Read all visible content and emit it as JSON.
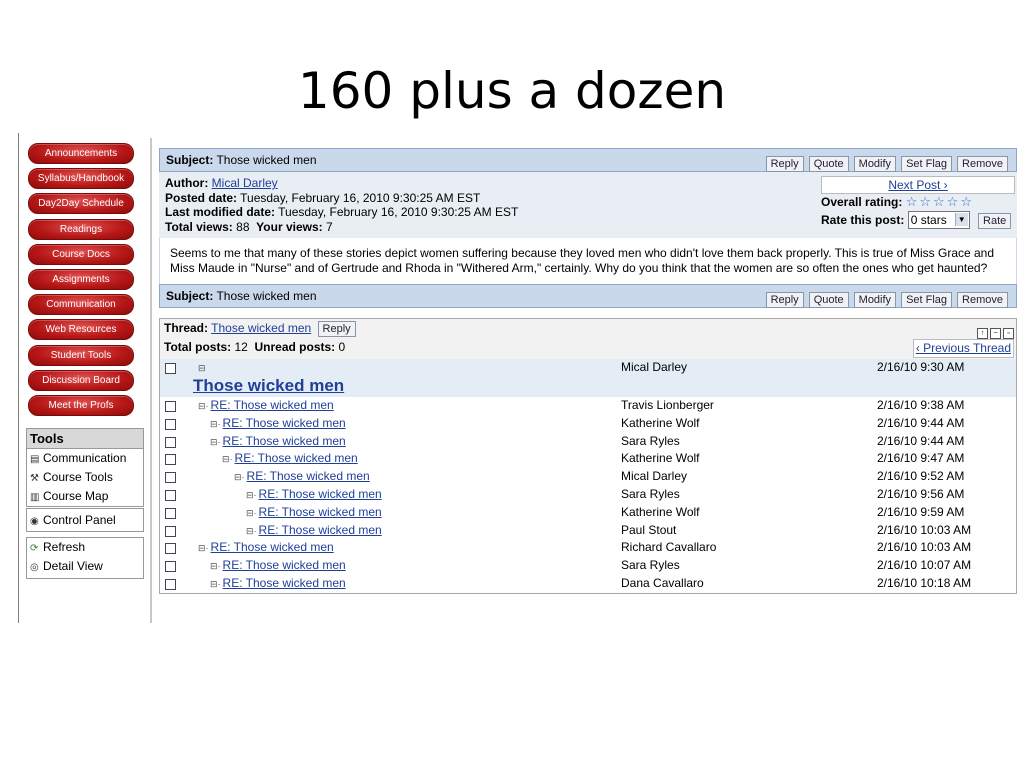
{
  "slide_title": "160 plus a dozen",
  "nav": [
    "Announcements",
    "Syllabus/Handbook",
    "Day2Day Schedule",
    "Readings",
    "Course Docs",
    "Assignments",
    "Communication",
    "Web Resources",
    "Student Tools",
    "Discussion Board",
    "Meet the Profs"
  ],
  "tools": {
    "header": "Tools",
    "items": [
      {
        "label": "Communication",
        "icon": "terminal-icon"
      },
      {
        "label": "Course Tools",
        "icon": "tools-icon"
      },
      {
        "label": "Course Map",
        "icon": "map-icon"
      }
    ]
  },
  "control_panel": "Control Panel",
  "refresh": "Refresh",
  "detail_view": "Detail View",
  "post": {
    "subject_label": "Subject:",
    "subject": "Those wicked men",
    "buttons": [
      "Reply",
      "Quote",
      "Modify",
      "Set Flag",
      "Remove"
    ],
    "author_label": "Author:",
    "author": "Mical Darley",
    "posted_label": "Posted date:",
    "posted": "Tuesday, February 16, 2010 9:30:25 AM EST",
    "modified_label": "Last modified date:",
    "modified": "Tuesday, February 16, 2010 9:30:25 AM EST",
    "total_views_label": "Total views:",
    "total_views": "88",
    "your_views_label": "Your views:",
    "your_views": "7",
    "next_post": "Next Post ›",
    "overall_rating_label": "Overall rating:",
    "overall_rating_stars": 0,
    "rate_label": "Rate this post:",
    "rate_value": "0 stars",
    "rate_button": "Rate",
    "body": "Seems to me that many of these stories depict women suffering because they loved men who didn't love them back properly. This is true of Miss Grace and Miss Maude in \"Nurse\" and of Gertrude and Rhoda in \"Withered Arm,\" certainly. Why do you think that the women are so often the ones who get haunted?"
  },
  "thread": {
    "label": "Thread:",
    "name": "Those wicked men",
    "reply": "Reply",
    "total_posts_label": "Total posts:",
    "total_posts": "12",
    "unread_label": "Unread posts:",
    "unread": "0",
    "prev_thread": "‹ Previous Thread",
    "top": {
      "title": "Those wicked men",
      "author": "Mical Darley",
      "date": "2/16/10 9:30 AM"
    },
    "rows": [
      {
        "title": "RE: Those wicked men",
        "author": "Travis Lionberger",
        "date": "2/16/10 9:38 AM",
        "depth": 1
      },
      {
        "title": "RE: Those wicked men",
        "author": "Katherine Wolf",
        "date": "2/16/10 9:44 AM",
        "depth": 2
      },
      {
        "title": "RE: Those wicked men",
        "author": "Sara Ryles",
        "date": "2/16/10 9:44 AM",
        "depth": 2
      },
      {
        "title": "RE: Those wicked men",
        "author": "Katherine Wolf",
        "date": "2/16/10 9:47 AM",
        "depth": 3
      },
      {
        "title": "RE: Those wicked men",
        "author": "Mical Darley",
        "date": "2/16/10 9:52 AM",
        "depth": 4
      },
      {
        "title": "RE: Those wicked men",
        "author": "Sara Ryles",
        "date": "2/16/10 9:56 AM",
        "depth": 5
      },
      {
        "title": "RE: Those wicked men",
        "author": "Katherine Wolf",
        "date": "2/16/10 9:59 AM",
        "depth": 5
      },
      {
        "title": "RE: Those wicked men",
        "author": "Paul Stout",
        "date": "2/16/10 10:03 AM",
        "depth": 5
      },
      {
        "title": "RE: Those wicked men",
        "author": "Richard Cavallaro",
        "date": "2/16/10 10:03 AM",
        "depth": 1
      },
      {
        "title": "RE: Those wicked men",
        "author": "Sara Ryles",
        "date": "2/16/10 10:07 AM",
        "depth": 2
      },
      {
        "title": "RE: Those wicked men",
        "author": "Dana Cavallaro",
        "date": "2/16/10 10:18 AM",
        "depth": 2
      }
    ]
  }
}
